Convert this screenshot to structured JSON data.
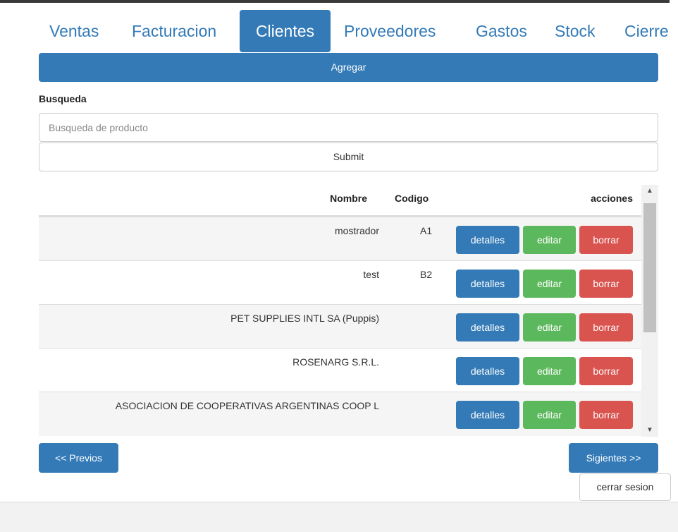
{
  "nav": {
    "tabs": [
      {
        "label": "Ventas"
      },
      {
        "label": "Facturacion"
      },
      {
        "label": "Clientes"
      },
      {
        "label": "Proveedores"
      },
      {
        "label": "Gastos"
      },
      {
        "label": "Stock"
      },
      {
        "label": "Cierre"
      }
    ],
    "active": "Clientes"
  },
  "actions": {
    "add_label": "Agregar"
  },
  "search": {
    "label": "Busqueda",
    "placeholder": "Busqueda de producto",
    "value": "",
    "submit_label": "Submit"
  },
  "table": {
    "headers": {
      "name": "Nombre",
      "code": "Codigo",
      "actions": "acciones"
    },
    "rows": [
      {
        "name": "mostrador",
        "code": "A1"
      },
      {
        "name": "test",
        "code": "B2"
      },
      {
        "name": "PET SUPPLIES INTL SA (Puppis)",
        "code": ""
      },
      {
        "name": "ROSENARG S.R.L.",
        "code": ""
      },
      {
        "name": "ASOCIACION DE COOPERATIVAS ARGENTINAS COOP L",
        "code": ""
      }
    ],
    "row_actions": {
      "details": "detalles",
      "edit": "editar",
      "delete": "borrar"
    }
  },
  "pagination": {
    "prev_label": "<< Previos",
    "next_label": "Sigientes >>"
  },
  "session": {
    "logout_label": "cerrar sesion"
  },
  "colors": {
    "primary": "#337ab7",
    "success": "#5cb85c",
    "danger": "#d9534f"
  }
}
